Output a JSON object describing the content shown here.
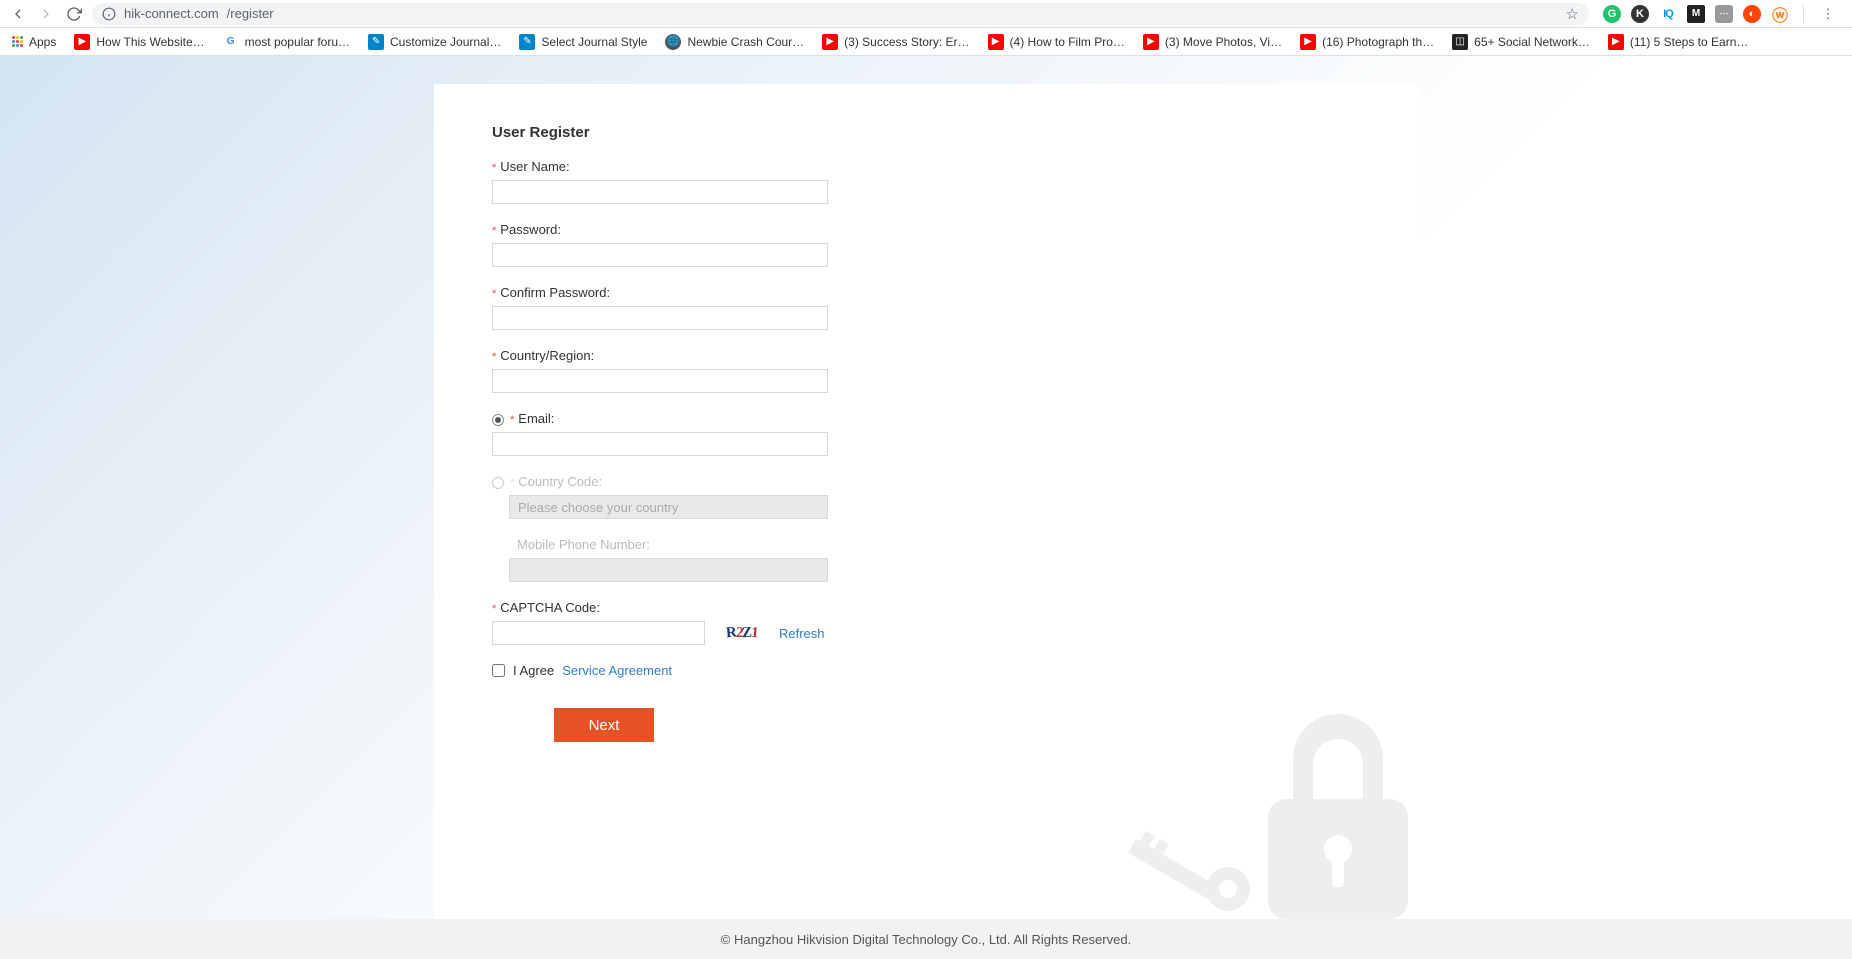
{
  "browser": {
    "url_host": "hik-connect.com",
    "url_path": "/register"
  },
  "bookmarks": [
    {
      "label": "Apps",
      "icon": "apps"
    },
    {
      "label": "How This Website…",
      "icon": "yt"
    },
    {
      "label": "most popular foru…",
      "icon": "google"
    },
    {
      "label": "Customize Journal…",
      "icon": "journal"
    },
    {
      "label": "Select Journal Style",
      "icon": "journal"
    },
    {
      "label": "Newbie Crash Cour…",
      "icon": "globe"
    },
    {
      "label": "(3) Success Story: Er…",
      "icon": "yt"
    },
    {
      "label": "(4) How to Film Pro…",
      "icon": "yt"
    },
    {
      "label": "(3) Move Photos, Vi…",
      "icon": "yt"
    },
    {
      "label": "(16) Photograph th…",
      "icon": "yt"
    },
    {
      "label": "65+ Social Network…",
      "icon": "social"
    },
    {
      "label": "(11) 5 Steps to Earn…",
      "icon": "yt"
    }
  ],
  "form": {
    "title": "User Register",
    "username_label": "User Name:",
    "password_label": "Password:",
    "confirm_label": "Confirm Password:",
    "country_label": "Country/Region:",
    "email_label": "Email:",
    "country_code_label": "Country Code:",
    "country_code_placeholder": "Please choose your country",
    "phone_label": "Mobile Phone Number:",
    "captcha_label": "CAPTCHA Code:",
    "captcha_text": "R2Z1",
    "refresh_label": "Refresh",
    "agree_label": "I Agree",
    "service_link": "Service Agreement",
    "next_label": "Next"
  },
  "footer": {
    "copyright": "© Hangzhou Hikvision Digital Technology Co., Ltd. All Rights Reserved."
  }
}
